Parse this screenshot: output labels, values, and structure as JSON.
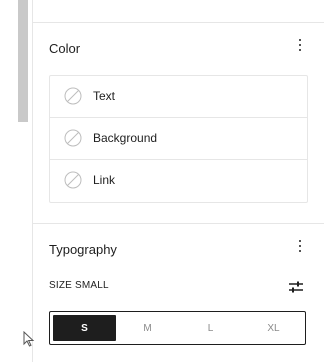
{
  "color_section": {
    "title": "Color",
    "items": [
      {
        "label": "Text"
      },
      {
        "label": "Background"
      },
      {
        "label": "Link"
      }
    ]
  },
  "typography_section": {
    "title": "Typography",
    "size_label": "SIZE SMALL",
    "sizes": [
      {
        "label": "S",
        "selected": true
      },
      {
        "label": "M",
        "selected": false
      },
      {
        "label": "L",
        "selected": false
      },
      {
        "label": "XL",
        "selected": false
      }
    ]
  },
  "colors": {
    "text": "#1e1e1e",
    "border": "#e6e6e6",
    "muted": "#8a8a8a",
    "scroll_thumb": "#c9c9c9"
  },
  "icons": {
    "options": "kebab-menu-icon",
    "swatch": "no-color-swatch-icon",
    "size_controls": "sliders-icon",
    "cursor": "mouse-pointer-icon"
  }
}
